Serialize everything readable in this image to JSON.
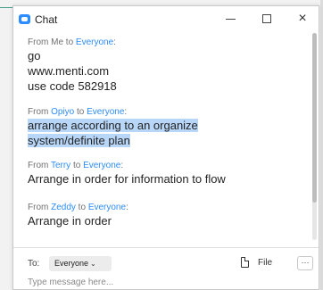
{
  "window": {
    "title": "Chat",
    "icons": {
      "app": "chat-bubble-icon",
      "minimize": "minimize-icon",
      "maximize": "maximize-icon",
      "close": "close-icon"
    },
    "close_glyph": "×"
  },
  "messages": [
    {
      "prefix": "From ",
      "sender": "Me",
      "middle": " to ",
      "recipient": "Everyone",
      "suffix": ":",
      "lines": [
        "go",
        "www.menti.com",
        "use code 582918"
      ],
      "highlighted": false
    },
    {
      "prefix": "From ",
      "sender": "Opiyo",
      "middle": " to ",
      "recipient": "Everyone",
      "suffix": ":",
      "lines": [
        "arrange according to an organize",
        "system/definite plan"
      ],
      "highlighted": true
    },
    {
      "prefix": "From ",
      "sender": "Terry",
      "middle": " to ",
      "recipient": "Everyone",
      "suffix": ":",
      "lines": [
        "Arrange in order for information to flow"
      ],
      "highlighted": false
    },
    {
      "prefix": "From ",
      "sender": "Zeddy",
      "middle": " to ",
      "recipient": "Everyone",
      "suffix": ":",
      "lines": [
        "Arrange in order"
      ],
      "highlighted": false
    }
  ],
  "composer": {
    "to_label": "To:",
    "recipient_selected": "Everyone",
    "chevron": "⌄",
    "file_label": "File",
    "more_glyph": "···",
    "placeholder": "Type message here...",
    "value": "",
    "icons": {
      "file": "file-icon",
      "more": "more-icon",
      "chevron": "chevron-down-icon"
    }
  },
  "colors": {
    "accent": "#2d8cff",
    "highlight": "#b8d6f8"
  }
}
